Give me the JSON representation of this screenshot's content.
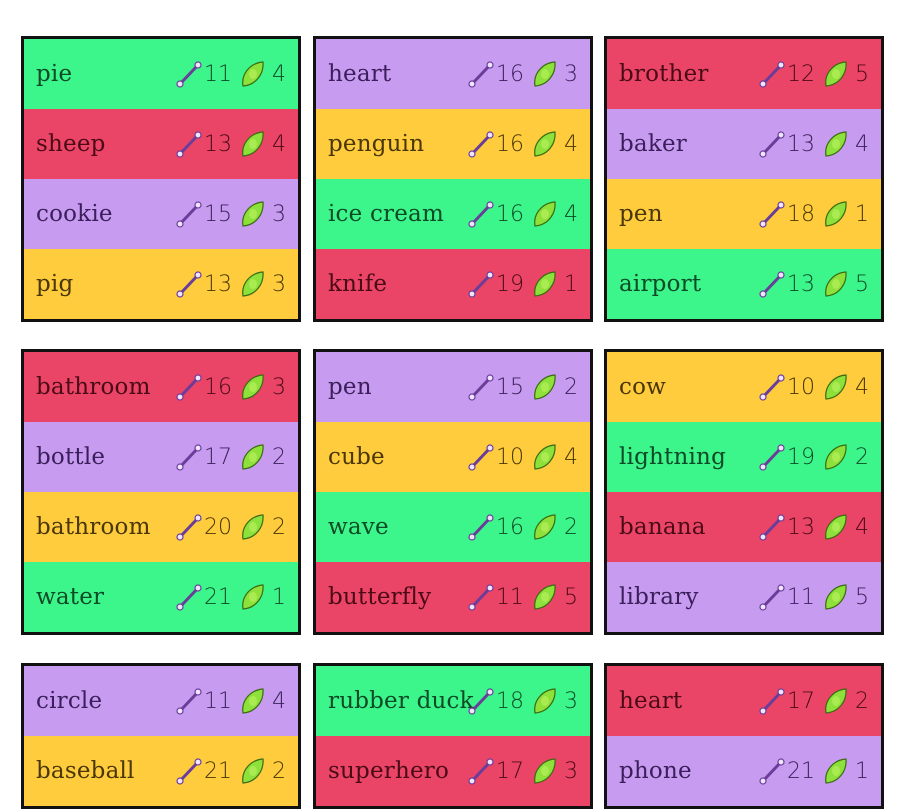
{
  "colors": {
    "green": "#3cf58b",
    "red": "#ea4466",
    "purple": "#c79bef",
    "yellow": "#fecc3d",
    "border": "#111111"
  },
  "icons": {
    "length": "ruler-icon",
    "points": "leaf-icon"
  },
  "cards": [
    {
      "rows": [
        {
          "word": "pie",
          "length": "11",
          "points": "4",
          "color": "green"
        },
        {
          "word": "sheep",
          "length": "13",
          "points": "4",
          "color": "red"
        },
        {
          "word": "cookie",
          "length": "15",
          "points": "3",
          "color": "purple"
        },
        {
          "word": "pig",
          "length": "13",
          "points": "3",
          "color": "yellow"
        }
      ]
    },
    {
      "rows": [
        {
          "word": "heart",
          "length": "16",
          "points": "3",
          "color": "purple"
        },
        {
          "word": "penguin",
          "length": "16",
          "points": "4",
          "color": "yellow"
        },
        {
          "word": "ice cream",
          "length": "16",
          "points": "4",
          "color": "green"
        },
        {
          "word": "knife",
          "length": "19",
          "points": "1",
          "color": "red"
        }
      ]
    },
    {
      "rows": [
        {
          "word": "brother",
          "length": "12",
          "points": "5",
          "color": "red"
        },
        {
          "word": "baker",
          "length": "13",
          "points": "4",
          "color": "purple"
        },
        {
          "word": "pen",
          "length": "18",
          "points": "1",
          "color": "yellow"
        },
        {
          "word": "airport",
          "length": "13",
          "points": "5",
          "color": "green"
        }
      ]
    },
    {
      "rows": [
        {
          "word": "bathroom",
          "length": "16",
          "points": "3",
          "color": "red"
        },
        {
          "word": "bottle",
          "length": "17",
          "points": "2",
          "color": "purple"
        },
        {
          "word": "bathroom",
          "length": "20",
          "points": "2",
          "color": "yellow"
        },
        {
          "word": "water",
          "length": "21",
          "points": "1",
          "color": "green"
        }
      ]
    },
    {
      "rows": [
        {
          "word": "pen",
          "length": "15",
          "points": "2",
          "color": "purple"
        },
        {
          "word": "cube",
          "length": "10",
          "points": "4",
          "color": "yellow"
        },
        {
          "word": "wave",
          "length": "16",
          "points": "2",
          "color": "green"
        },
        {
          "word": "butterfly",
          "length": "11",
          "points": "5",
          "color": "red"
        }
      ]
    },
    {
      "rows": [
        {
          "word": "cow",
          "length": "10",
          "points": "4",
          "color": "yellow"
        },
        {
          "word": "lightning",
          "length": "19",
          "points": "2",
          "color": "green"
        },
        {
          "word": "banana",
          "length": "13",
          "points": "4",
          "color": "red"
        },
        {
          "word": "library",
          "length": "11",
          "points": "5",
          "color": "purple"
        }
      ]
    },
    {
      "rows": [
        {
          "word": "circle",
          "length": "11",
          "points": "4",
          "color": "purple"
        },
        {
          "word": "baseball",
          "length": "21",
          "points": "2",
          "color": "yellow"
        }
      ]
    },
    {
      "rows": [
        {
          "word": "rubber duck",
          "length": "18",
          "points": "3",
          "color": "green"
        },
        {
          "word": "superhero",
          "length": "17",
          "points": "3",
          "color": "red"
        }
      ]
    },
    {
      "rows": [
        {
          "word": "heart",
          "length": "17",
          "points": "2",
          "color": "red"
        },
        {
          "word": "phone",
          "length": "21",
          "points": "1",
          "color": "purple"
        }
      ]
    }
  ]
}
